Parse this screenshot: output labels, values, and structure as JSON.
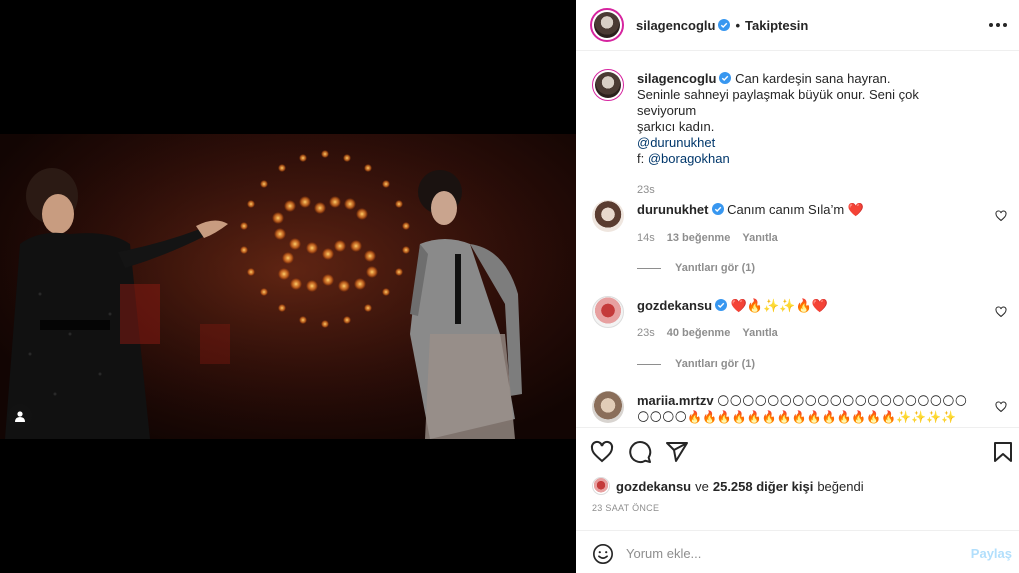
{
  "post": {
    "username": "silagencoglu",
    "follow_status": "Takiptesin",
    "caption_line1": "Can kardeşin sana hayran.",
    "caption_line2": "Seninle sahneyi paylaşmak büyük onur. Seni çok seviyorum",
    "caption_line3": "şarkıcı kadın.",
    "caption_mention": "@durunukhet",
    "caption_credit_prefix": "f:",
    "caption_credit_mention": "@boragokhan",
    "caption_time": "23s"
  },
  "comments": [
    {
      "username": "durunukhet",
      "text": "Canım canım Sıla’m ❤️",
      "time": "14s",
      "likes": "13 beğenme",
      "reply": "Yanıtla",
      "view_replies": "Yanıtları gör (1)"
    },
    {
      "username": "gozdekansu",
      "text": "❤️🔥✨✨🔥❤️",
      "time": "23s",
      "likes": "40 beğenme",
      "reply": "Yanıtla",
      "view_replies": "Yanıtları gör (1)"
    },
    {
      "username": "mariia.mrtzv",
      "text": "🌕🌕🌕🌕🌕🌕🌕🌕🌕🌕🌕🌕🌕🌕🌕🌕🌕🌕🌕🌕🌕🌕🌕🌕🔥🔥🔥🔥🔥🔥🔥🔥🔥🔥🔥🔥🔥🔥✨✨✨✨"
    }
  ],
  "liked_by": {
    "user": "gozdekansu",
    "connector": "ve",
    "others": "25.258 diğer kişi",
    "suffix": "beğendi"
  },
  "time_ago": "23 SAAT ÖNCE",
  "comment_input": {
    "placeholder": "Yorum ekle..."
  },
  "share_label": "Paylaş",
  "colors": {
    "verified": "#3897f0",
    "link": "#00376b",
    "muted": "#8e8e8e",
    "share_disabled": "#b2dffc"
  }
}
